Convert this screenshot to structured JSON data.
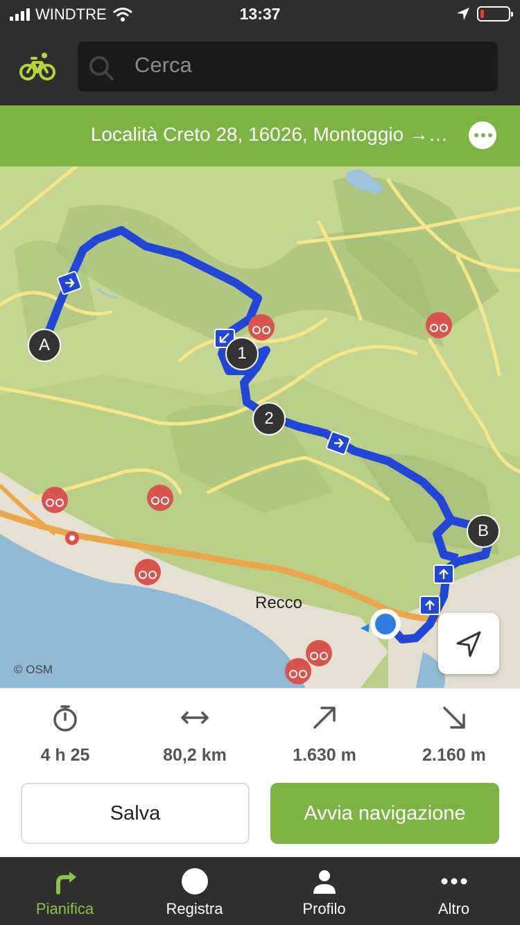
{
  "status_bar": {
    "carrier": "WINDTRE",
    "time": "13:37"
  },
  "search": {
    "placeholder": "Cerca"
  },
  "route": {
    "title": "Località Creto 28, 16026, Montoggio →…"
  },
  "map": {
    "attribution": "© OSM",
    "places": [
      "Recco"
    ],
    "waypoints": [
      "A",
      "1",
      "2",
      "B"
    ]
  },
  "stats": [
    {
      "icon": "stopwatch-icon",
      "value": "4 h 25"
    },
    {
      "icon": "distance-icon",
      "value": "80,2 km"
    },
    {
      "icon": "ascent-icon",
      "value": "1.630 m"
    },
    {
      "icon": "descent-icon",
      "value": "2.160 m"
    }
  ],
  "actions": {
    "save": "Salva",
    "start_navigation": "Avvia navigazione"
  },
  "tabs": [
    {
      "label": "Pianifica",
      "active": true
    },
    {
      "label": "Registra",
      "active": false
    },
    {
      "label": "Profilo",
      "active": false
    },
    {
      "label": "Altro",
      "active": false
    }
  ],
  "colors": {
    "accent": "#7cb342",
    "route": "#2247d6",
    "header": "#2f2f2f",
    "poi": "#d9534f"
  }
}
